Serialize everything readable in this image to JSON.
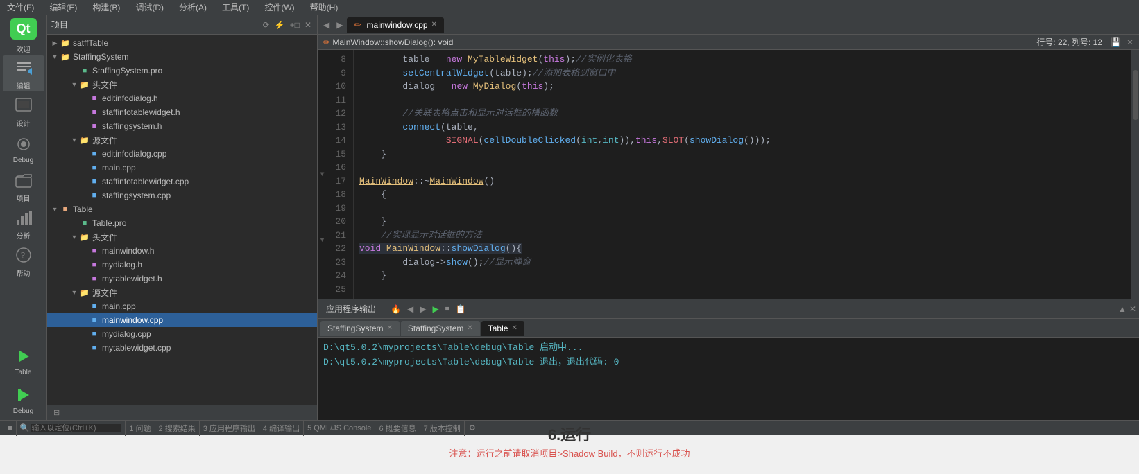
{
  "menubar": {
    "items": [
      "文件(F)",
      "编辑(E)",
      "构建(B)",
      "调试(D)",
      "分析(A)",
      "工具(T)",
      "控件(W)",
      "帮助(H)"
    ]
  },
  "left_toolbar": {
    "buttons": [
      {
        "label": "欢迎",
        "name": "welcome-btn"
      },
      {
        "label": "编辑",
        "name": "edit-btn"
      },
      {
        "label": "设计",
        "name": "design-btn"
      },
      {
        "label": "Debug",
        "name": "debug-btn"
      },
      {
        "label": "项目",
        "name": "project-btn"
      },
      {
        "label": "分析",
        "name": "analyze-btn"
      },
      {
        "label": "帮助",
        "name": "help-btn"
      }
    ],
    "bottom_buttons": [
      {
        "label": "Table",
        "name": "table-run-btn"
      },
      {
        "label": "Debug",
        "name": "debug-run-btn"
      }
    ]
  },
  "side_panel": {
    "header": "项目",
    "tree": [
      {
        "label": "satffTable",
        "level": 0,
        "type": "folder",
        "expanded": false,
        "indent": "indent-0"
      },
      {
        "label": "StaffingSystem",
        "level": 0,
        "type": "folder",
        "expanded": true,
        "indent": "indent-1"
      },
      {
        "label": "StaffingSystem.pro",
        "level": 1,
        "type": "pro",
        "indent": "indent-2"
      },
      {
        "label": "头文件",
        "level": 1,
        "type": "folder",
        "expanded": true,
        "indent": "indent-2"
      },
      {
        "label": "editinfodialog.h",
        "level": 2,
        "type": "h",
        "indent": "indent-3"
      },
      {
        "label": "staffinfotablewidget.h",
        "level": 2,
        "type": "h",
        "indent": "indent-3"
      },
      {
        "label": "staffingsystem.h",
        "level": 2,
        "type": "h",
        "indent": "indent-3"
      },
      {
        "label": "源文件",
        "level": 1,
        "type": "folder",
        "expanded": true,
        "indent": "indent-2"
      },
      {
        "label": "editinfodialog.cpp",
        "level": 2,
        "type": "cpp",
        "indent": "indent-3"
      },
      {
        "label": "main.cpp",
        "level": 2,
        "type": "cpp",
        "indent": "indent-3"
      },
      {
        "label": "staffinfotablewidget.cpp",
        "level": 2,
        "type": "cpp",
        "indent": "indent-3"
      },
      {
        "label": "staffingsystem.cpp",
        "level": 2,
        "type": "cpp",
        "indent": "indent-3"
      },
      {
        "label": "Table",
        "level": 0,
        "type": "folder",
        "expanded": true,
        "indent": "indent-1"
      },
      {
        "label": "Table.pro",
        "level": 1,
        "type": "pro",
        "indent": "indent-2"
      },
      {
        "label": "头文件",
        "level": 1,
        "type": "folder",
        "expanded": true,
        "indent": "indent-2"
      },
      {
        "label": "mainwindow.h",
        "level": 2,
        "type": "h",
        "indent": "indent-3"
      },
      {
        "label": "mydialog.h",
        "level": 2,
        "type": "h",
        "indent": "indent-3"
      },
      {
        "label": "mytablewidget.h",
        "level": 2,
        "type": "h",
        "indent": "indent-3"
      },
      {
        "label": "源文件",
        "level": 1,
        "type": "folder",
        "expanded": true,
        "indent": "indent-2"
      },
      {
        "label": "main.cpp",
        "level": 2,
        "type": "cpp",
        "indent": "indent-3"
      },
      {
        "label": "mainwindow.cpp",
        "level": 2,
        "type": "cpp",
        "selected": true,
        "indent": "indent-3"
      },
      {
        "label": "mydialog.cpp",
        "level": 2,
        "type": "cpp",
        "indent": "indent-3"
      },
      {
        "label": "mytablewidget.cpp",
        "level": 2,
        "type": "cpp",
        "indent": "indent-3"
      }
    ]
  },
  "editor": {
    "tabs": [
      {
        "label": "mainwindow.cpp",
        "active": true,
        "name": "mainwindow-tab"
      }
    ],
    "status": "行号: 22, 列号: 12",
    "filename": "MainWindow::showDialog(): void",
    "lines": [
      {
        "num": 8,
        "content": "        table = new MyTableWidget(this);//实例化表格",
        "fold": false
      },
      {
        "num": 9,
        "content": "        setCentralWidget(table);//添加表格到窗口中",
        "fold": false
      },
      {
        "num": 10,
        "content": "        dialog = new MyDialog(this);",
        "fold": false
      },
      {
        "num": 11,
        "content": "",
        "fold": false
      },
      {
        "num": 12,
        "content": "        //关联表格点击和显示对话框的槽函数",
        "fold": false
      },
      {
        "num": 13,
        "content": "        connect(table,",
        "fold": false
      },
      {
        "num": 14,
        "content": "                SIGNAL(cellDoubleClicked(int,int)),this,SLOT(showDialog()));",
        "fold": false
      },
      {
        "num": 15,
        "content": "    }",
        "fold": false
      },
      {
        "num": 16,
        "content": "",
        "fold": false
      },
      {
        "num": 17,
        "content": "MainWindow::~MainWindow()",
        "fold": true
      },
      {
        "num": 18,
        "content": "    {",
        "fold": false
      },
      {
        "num": 19,
        "content": "",
        "fold": false
      },
      {
        "num": 20,
        "content": "    }",
        "fold": false
      },
      {
        "num": 21,
        "content": "    //实现显示对话框的方法",
        "fold": false
      },
      {
        "num": 22,
        "content": "void MainWindow::showDialog(){",
        "fold": true,
        "highlight": true
      },
      {
        "num": 23,
        "content": "        dialog->show();//显示弹窗",
        "fold": false
      },
      {
        "num": 24,
        "content": "    }",
        "fold": false
      },
      {
        "num": 25,
        "content": "",
        "fold": false
      }
    ]
  },
  "output_panel": {
    "title": "应用程序输出",
    "tools": [
      "🔥",
      "◀",
      "▶",
      "▶",
      "⏹",
      "📋"
    ],
    "tabs": [
      {
        "label": "StaffingSystem",
        "active": false
      },
      {
        "label": "StaffingSystem",
        "active": false
      },
      {
        "label": "Table",
        "active": true
      }
    ],
    "content": [
      "D:\\qt5.0.2\\myprojects\\Table\\debug\\Table 启动中...",
      "D:\\qt5.0.2\\myprojects\\Table\\debug\\Table 退出，退出代码: 0"
    ]
  },
  "status_bar": {
    "items": [
      "1 问题",
      "2 搜索结果",
      "3 应用程序输出",
      "4 编译输出",
      "5 QML/JS Console",
      "6 概要信息",
      "7 版本控制"
    ],
    "search_placeholder": "输入以定位(Ctrl+K)"
  },
  "bottom_info": {
    "title": "6.运行",
    "note": "注意：运行之前请取消项目>Shadow Build，不则运行不成功"
  }
}
